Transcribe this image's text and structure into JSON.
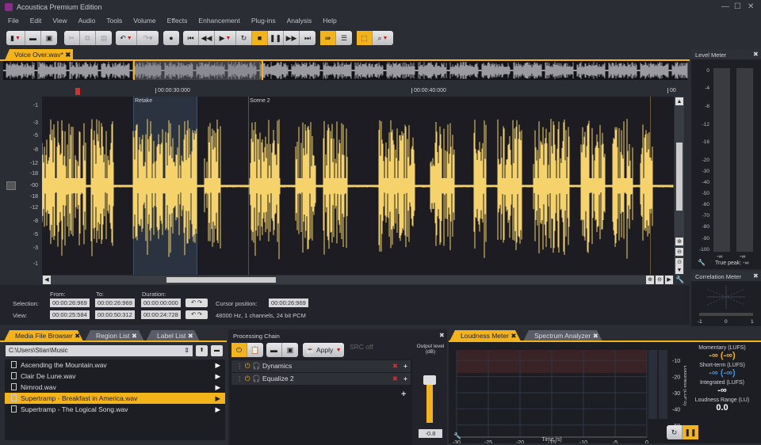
{
  "app": {
    "title": "Acoustica Premium Edition"
  },
  "menu": [
    "File",
    "Edit",
    "View",
    "Audio",
    "Tools",
    "Volume",
    "Effects",
    "Enhancement",
    "Plug-ins",
    "Analysis",
    "Help"
  ],
  "colors": {
    "accent": "#f3b41b",
    "waveform": "#f5d36a",
    "marker_scene": "#8a2c8a",
    "cursor": "#d03030"
  },
  "doc_tab": {
    "label": "Voice Over.wav*"
  },
  "timeline": {
    "labels": [
      "00:00:30:000",
      "00:00:40:000",
      "00"
    ],
    "regions": [
      "Retake",
      "Scene 2"
    ]
  },
  "amp_axis": [
    "-1",
    "-3",
    "-5",
    "-8",
    "-12",
    "-18",
    "-00",
    "-18",
    "-12",
    "-8",
    "-5",
    "-3",
    "-1"
  ],
  "selection": {
    "from_label": "From:",
    "to_label": "To:",
    "duration_label": "Duration:",
    "selection_label": "Selection:",
    "view_label": "View:",
    "sel_from": "00:00:26:969",
    "sel_to": "00:00:26:969",
    "sel_dur": "00:00:00:000",
    "view_from": "00:00:25:584",
    "view_to": "00:00:50:312",
    "view_dur": "00:00:24:728",
    "cursor_label": "Cursor position:",
    "cursor": "00:00:26:969",
    "format": "48000 Hz, 1 channels, 24 bit PCM"
  },
  "level_meter": {
    "title": "Level Meter",
    "scale": [
      "0",
      "-4",
      "-8",
      "-12",
      "-16",
      "-20",
      "-30",
      "-40",
      "-50",
      "-60",
      "-70",
      "-80",
      "-90",
      "-100"
    ],
    "left": "-∞",
    "right": "-∞",
    "true_peak": "True peak: -∞"
  },
  "correlation": {
    "title": "Correlation Meter",
    "scale": [
      "-1",
      "0",
      "1"
    ]
  },
  "browser": {
    "tabs": [
      "Media File Browser",
      "Region List",
      "Label List"
    ],
    "path": "C:\\Users\\Stian\\Music",
    "files": [
      "Ascending the Mountain.wav",
      "Clair De Lune.wav",
      "Nimrod.wav",
      "Supertramp - Breakfast in America.wav",
      "Supertramp - The Logical Song.wav"
    ],
    "selected_index": 3
  },
  "chain": {
    "title": "Processing Chain",
    "apply": "Apply",
    "src": "SRC off",
    "output_label": "Output level (dB)",
    "output_value": "-0.8",
    "effects": [
      "Dynamics",
      "Equalize 2"
    ]
  },
  "loudness": {
    "tabs": [
      "Loudness Meter",
      "Spectrum Analyzer"
    ],
    "x_ticks": [
      "-30",
      "-25",
      "-20",
      "-15",
      "-10",
      "-5",
      "0"
    ],
    "y_ticks": [
      "-10",
      "-20",
      "-30",
      "-40",
      "-50"
    ],
    "xlabel": "Time (s)",
    "ylabel": "Loudness (LUFS)",
    "momentary_label": "Momentary (LUFS)",
    "momentary": "-∞ (-∞)",
    "short_label": "Short-term (LUFS)",
    "short": "-∞ (-∞)",
    "integrated_label": "Integrated (LUFS)",
    "integrated": "-∞",
    "range_label": "Loudness Range (LU)",
    "range": "0.0"
  }
}
